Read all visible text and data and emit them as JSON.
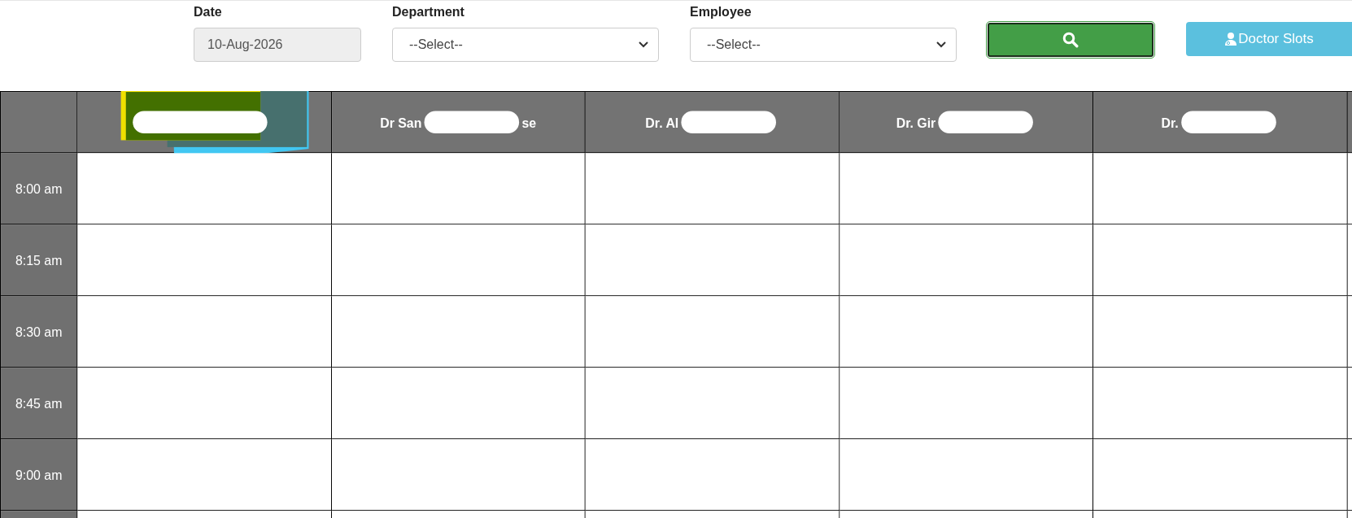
{
  "filters": {
    "date": {
      "label": "Date",
      "value": "10-Aug-2026",
      "disabled": true
    },
    "department": {
      "label": "Department",
      "value": "--Select--"
    },
    "employee": {
      "label": "Employee",
      "value": "--Select--"
    }
  },
  "buttons": [
    {
      "kind": "search"
    },
    {
      "kind": "doctor_slots",
      "label": "Doctor Slots"
    }
  ],
  "schedule": {
    "columns": [
      {
        "kind": "scribbled"
      },
      {
        "kind": "partial",
        "visible": [
          "Dr San",
          "se"
        ]
      },
      {
        "kind": "partial",
        "visible": [
          "Dr. Al"
        ]
      },
      {
        "kind": "partial",
        "visible": [
          "Dr. Gir"
        ]
      },
      {
        "kind": "partial",
        "visible": [
          "Dr."
        ]
      }
    ],
    "rows": [
      {
        "time": "8:00 am"
      },
      {
        "time": "8:15 am"
      },
      {
        "time": "8:30 am"
      },
      {
        "time": "8:45 am"
      },
      {
        "time": "9:00 am"
      }
    ]
  }
}
